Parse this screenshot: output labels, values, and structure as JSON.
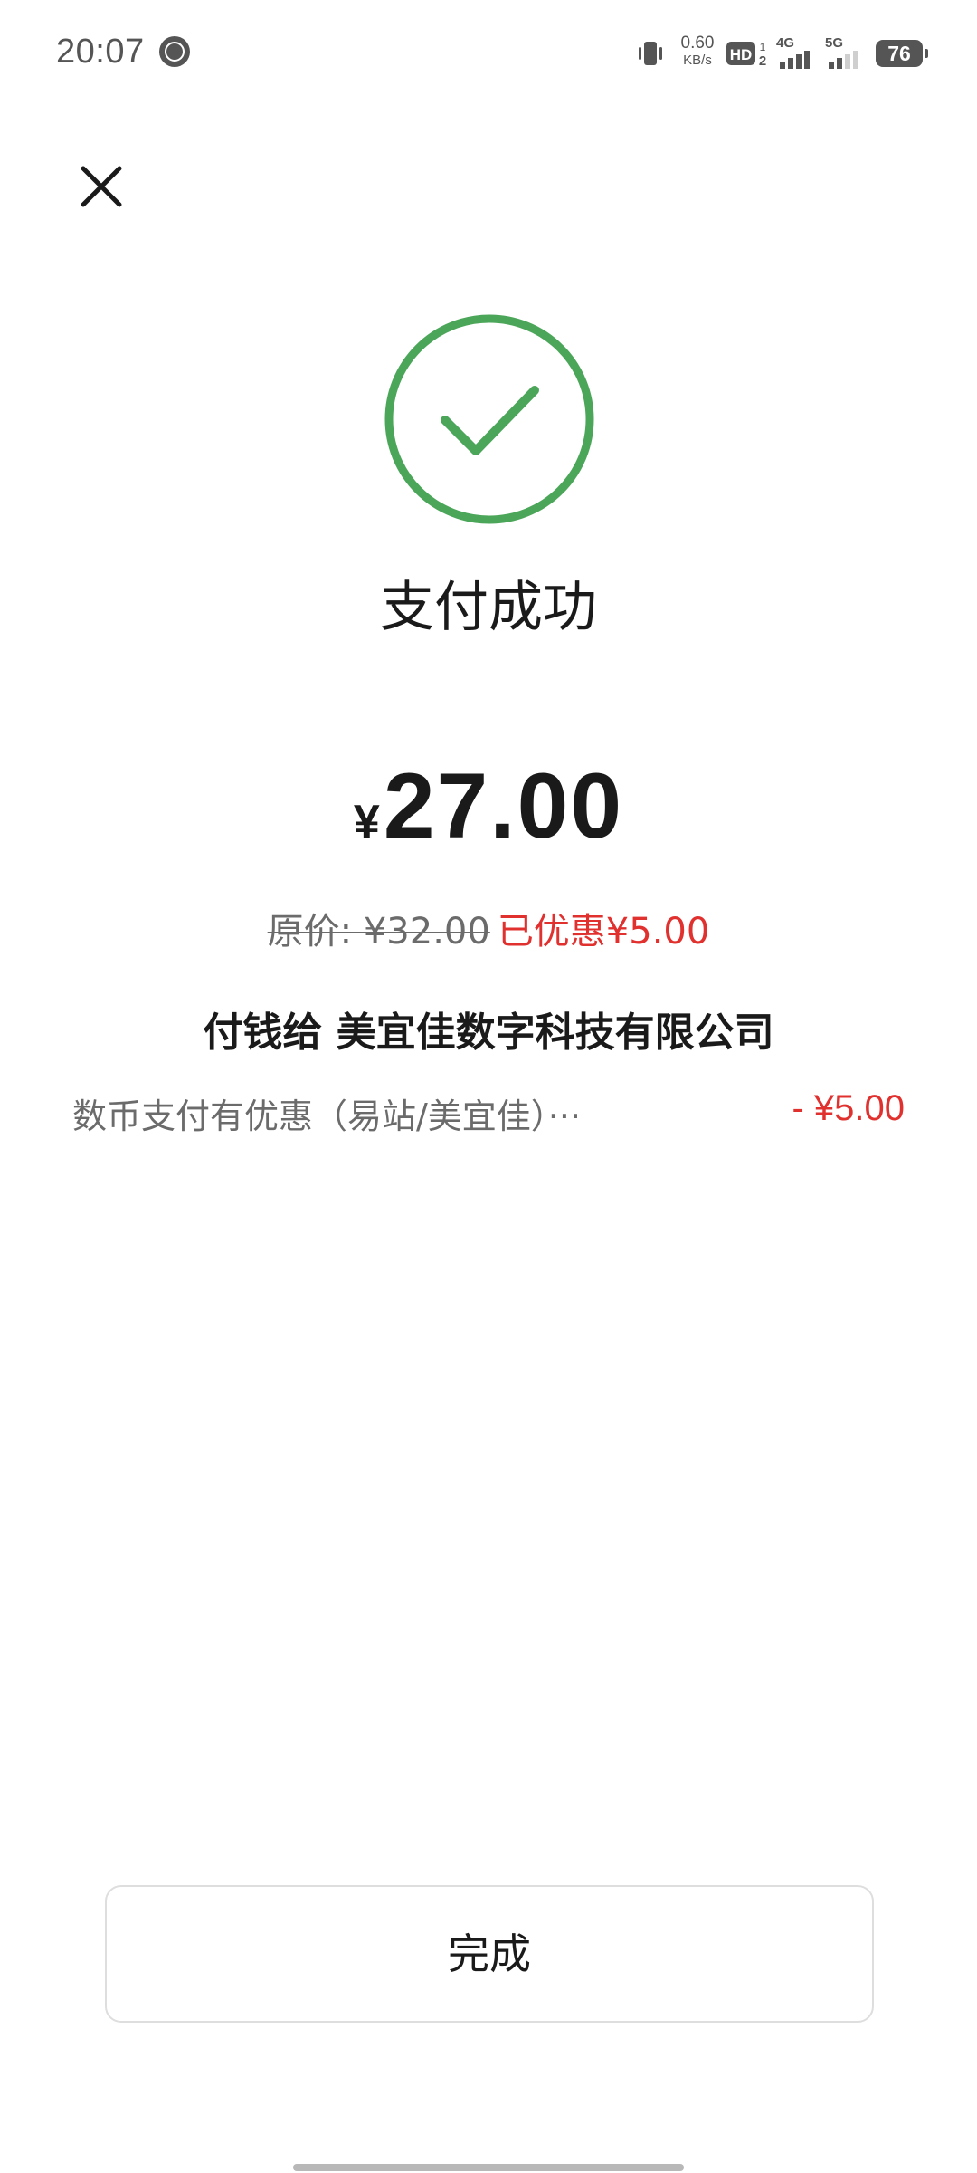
{
  "status_bar": {
    "time": "20:07",
    "net_speed_value": "0.60",
    "net_speed_unit": "KB/s",
    "network_1": "4G",
    "network_2": "5G",
    "battery_level": "76",
    "icons": [
      "app-notification-icon",
      "vibrate-icon",
      "hd-voice-icon",
      "signal-4g-icon",
      "signal-5g-icon",
      "battery-icon"
    ]
  },
  "header": {
    "close_icon": "close-icon"
  },
  "result": {
    "icon": "check-circle-icon",
    "icon_color": "#4CA65A",
    "title": "支付成功"
  },
  "amount": {
    "currency": "¥",
    "value": "27.00"
  },
  "price": {
    "original": "原价: ¥32.00",
    "discount": "已优惠¥5.00",
    "discount_color": "#E0312F"
  },
  "payee": {
    "text": "付钱给 美宜佳数字科技有限公司"
  },
  "discount_detail": {
    "label": "数币支付有优惠（易站/美宜佳）···",
    "amount": "- ¥5.00"
  },
  "footer": {
    "done_label": "完成"
  }
}
